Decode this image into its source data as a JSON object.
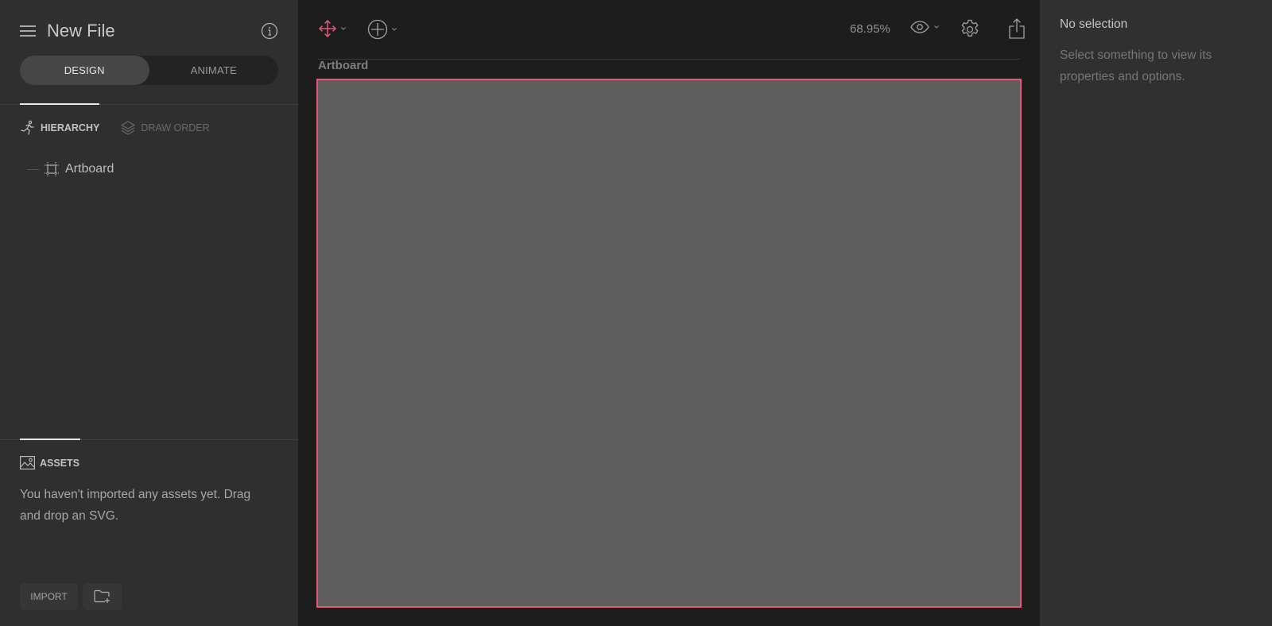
{
  "sidebar": {
    "file_title": "New File",
    "mode_tabs": [
      {
        "label": "DESIGN",
        "active": true
      },
      {
        "label": "ANIMATE",
        "active": false
      }
    ],
    "panel_tabs": [
      {
        "label": "HIERARCHY",
        "icon": "running-figure-icon",
        "active": true
      },
      {
        "label": "DRAW ORDER",
        "icon": "layers-icon",
        "active": false
      }
    ],
    "hierarchy": [
      {
        "label": "Artboard",
        "icon": "artboard-icon"
      }
    ],
    "assets": {
      "title": "ASSETS",
      "empty_message": "You haven't imported any assets yet. Drag and drop an SVG.",
      "import_label": "IMPORT"
    }
  },
  "toolbar": {
    "zoom_level": "68.95%",
    "accent_color": "#e9577a"
  },
  "canvas": {
    "artboard_label": "Artboard",
    "artboard_border_color": "#e9577a"
  },
  "inspector": {
    "title": "No selection",
    "description": "Select something to view its properties and options."
  }
}
